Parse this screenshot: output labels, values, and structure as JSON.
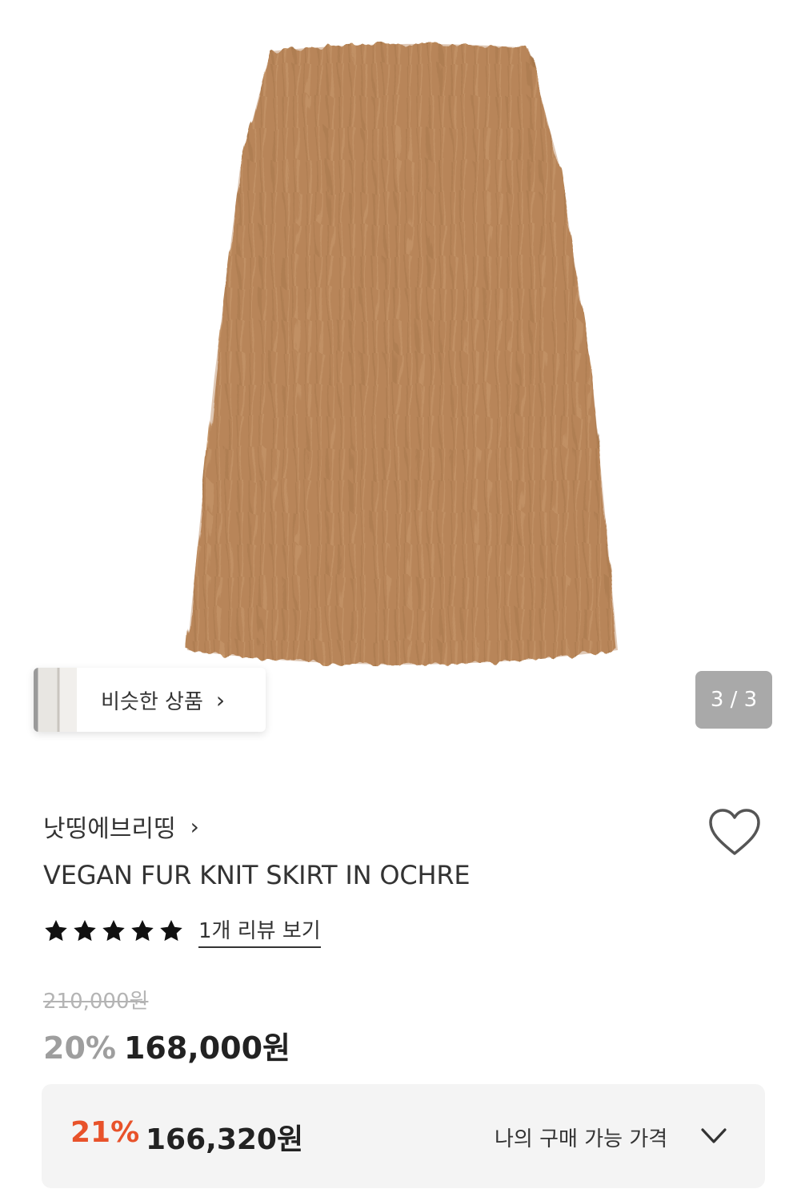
{
  "gallery": {
    "similar_label": "비슷한 상품",
    "similar_chevron": "›",
    "counter": "3 / 3"
  },
  "product": {
    "brand": "낫띵에브리띵",
    "brand_chevron": "›",
    "title": "VEGAN FUR KNIT SKIRT IN OCHRE",
    "rating": 5,
    "review_link": "1개 리뷰 보기",
    "original_price": "210,000원",
    "discount": "20%",
    "sale_price": "168,000원"
  },
  "member_price": {
    "discount": "21%",
    "price": "166,320원",
    "label": "나의 구매 가능 가격"
  },
  "colors": {
    "skirt": "#b9865a",
    "accent_red": "#e8522a",
    "counter_bg": "#a9a9a9"
  },
  "icons": {
    "like": "heart-icon",
    "star": "star-icon",
    "expand": "chevron-down-icon"
  }
}
